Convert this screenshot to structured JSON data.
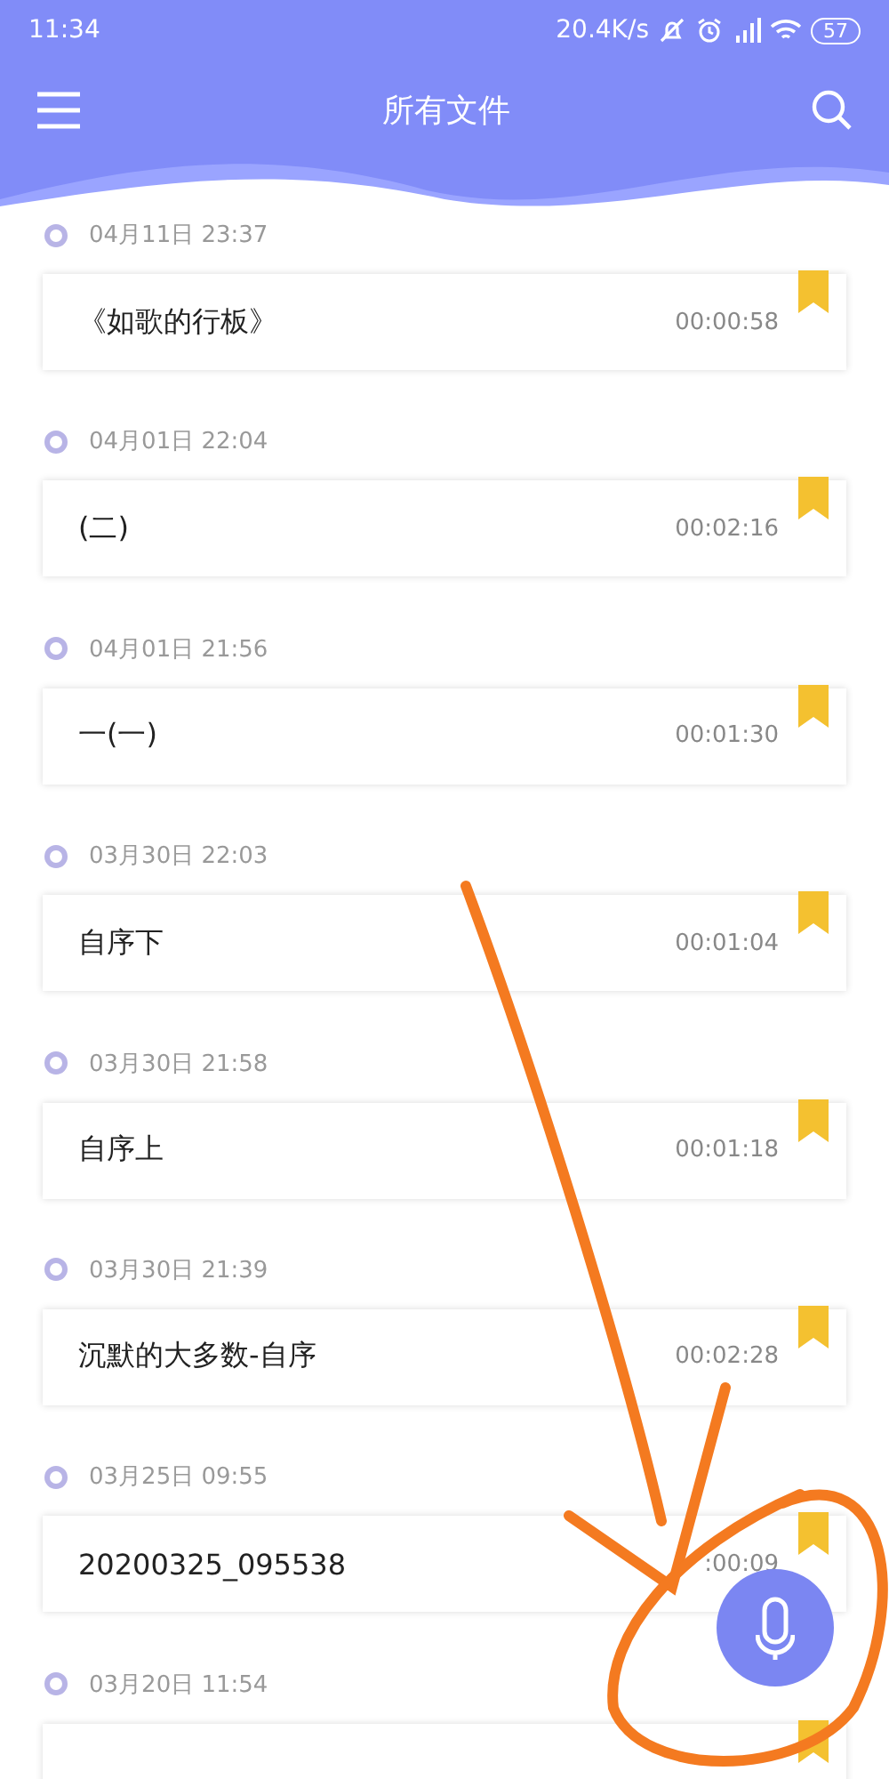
{
  "status_bar": {
    "time": "11:34",
    "speed": "20.4K/s",
    "battery": "57"
  },
  "toolbar": {
    "title": "所有文件"
  },
  "recordings": [
    {
      "date": "04月11日 23:37",
      "title": "《如歌的行板》",
      "duration": "00:00:58"
    },
    {
      "date": "04月01日 22:04",
      "title": "(二)",
      "duration": "00:02:16"
    },
    {
      "date": "04月01日 21:56",
      "title": "一(一)",
      "duration": "00:01:30"
    },
    {
      "date": "03月30日 22:03",
      "title": "自序下",
      "duration": "00:01:04"
    },
    {
      "date": "03月30日 21:58",
      "title": "自序上",
      "duration": "00:01:18"
    },
    {
      "date": "03月30日 21:39",
      "title": "沉默的大多数-自序",
      "duration": "00:02:28"
    },
    {
      "date": "03月25日 09:55",
      "title": "20200325_095538",
      "duration": ":00:09"
    },
    {
      "date": "03月20日 11:54"
    }
  ]
}
